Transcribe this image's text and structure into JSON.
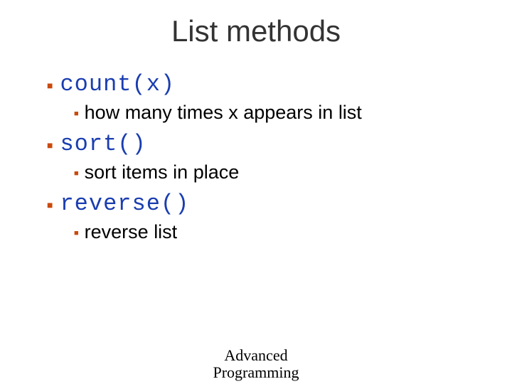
{
  "title": "List methods",
  "items": [
    {
      "method": "count(x)",
      "desc": "how many times x appears in list"
    },
    {
      "method": "sort()",
      "desc": "sort items in place"
    },
    {
      "method": "reverse()",
      "desc": "reverse list"
    }
  ],
  "footer": {
    "line1": "Advanced",
    "line2": "Programming"
  }
}
